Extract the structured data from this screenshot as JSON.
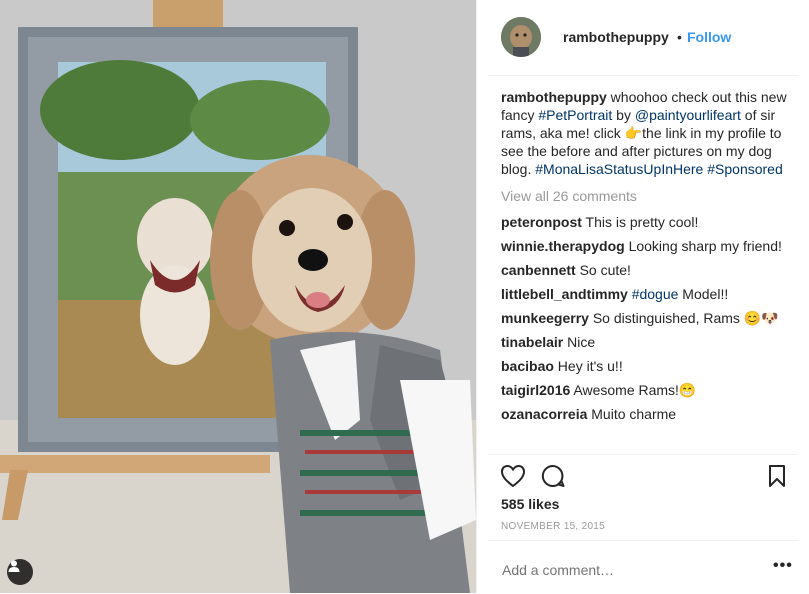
{
  "post": {
    "username": "rambothepuppy",
    "follow_label": "Follow",
    "dot": "•",
    "caption": {
      "username": "rambothepuppy",
      "t1": " whoohoo check out this new fancy ",
      "h1": "#PetPortrait",
      "t2": " by ",
      "h2": "@paintyourlifeart",
      "t3": " of sir rams, aka me! click ",
      "emoji": "👉",
      "t4": "the link in my profile to see the before and after pictures on my dog blog. ",
      "h3": "#MonaLisaStatusUpInHere",
      "t5": " ",
      "h4": "#Sponsored"
    },
    "view_all": "View all 26 comments",
    "comments": [
      {
        "user": "peteronpost",
        "text": " This is pretty cool!"
      },
      {
        "user": "winnie.therapydog",
        "text": " Looking sharp my friend!"
      },
      {
        "user": "canbennett",
        "text": " So cute!"
      },
      {
        "user": "littlebell_andtimmy",
        "tag": " #dogue",
        "text": " Model!!"
      },
      {
        "user": "munkeegerry",
        "text": " So distinguished, Rams 😊🐶"
      },
      {
        "user": "tinabelair",
        "text": " Nice"
      },
      {
        "user": "bacibao",
        "text": " Hey it's u!!"
      },
      {
        "user": "taigirl2016",
        "text": " Awesome Rams!😁"
      },
      {
        "user": "ozanacorreia",
        "text": " Muito charme"
      }
    ],
    "likes": "585 likes",
    "date": "NOVEMBER 15, 2015",
    "add_comment_placeholder": "Add a comment…",
    "more_label": "•••"
  },
  "icons": {
    "like": "heart-icon",
    "comment": "comment-bubble-icon",
    "save": "bookmark-icon",
    "tagged": "person-tag-icon"
  },
  "colors": {
    "link": "#003569",
    "follow": "#3897f0",
    "muted": "#999999",
    "text": "#262626"
  }
}
